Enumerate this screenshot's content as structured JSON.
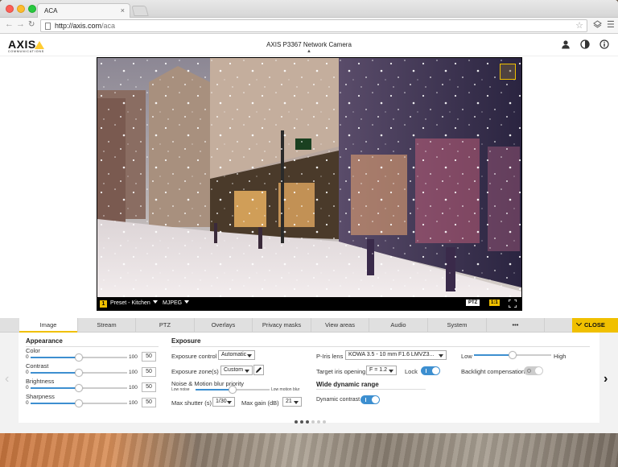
{
  "browser": {
    "tab_title": "ACA",
    "tab_close": "×",
    "url_host": "http://axis.com",
    "url_path": "/aca"
  },
  "header": {
    "logo_word": "AXIS",
    "logo_sub": "COMMUNICATIONS",
    "device_name": "AXIS P3367 Network Camera"
  },
  "video": {
    "preset_number": "1",
    "preset_label": "Preset - Kitchen",
    "codec": "MJPEG",
    "ptz_badge": "PTZ",
    "scale_badge": "1:1"
  },
  "tabs": [
    {
      "label": "Image"
    },
    {
      "label": "Stream"
    },
    {
      "label": "PTZ"
    },
    {
      "label": "Overlays"
    },
    {
      "label": "Privacy masks"
    },
    {
      "label": "View areas"
    },
    {
      "label": "Audio"
    },
    {
      "label": "System"
    },
    {
      "label": "•••"
    }
  ],
  "close_label": "CLOSE",
  "appearance": {
    "title": "Appearance",
    "sliders": [
      {
        "label": "Color",
        "min": "0",
        "max": "100",
        "value": "50",
        "level": 0.5
      },
      {
        "label": "Contrast",
        "min": "0",
        "max": "100",
        "value": "50",
        "level": 0.5
      },
      {
        "label": "Brightness",
        "min": "0",
        "max": "100",
        "value": "50",
        "level": 0.5
      },
      {
        "label": "Sharpness",
        "min": "0",
        "max": "100",
        "value": "50",
        "level": 0.5
      }
    ]
  },
  "exposure": {
    "title": "Exposure",
    "control_label": "Exposure control",
    "control_value": "Automatic",
    "zones_label": "Exposure zone(s)",
    "zones_value": "Custom",
    "priority_label": "Noise & Motion blur priority",
    "low_noise": "Low noise",
    "low_motion_blur": "Low motion blur",
    "priority_level": 0.5,
    "shutter_label": "Max shutter (s)",
    "shutter_value": "1/30",
    "gain_label": "Max gain (dB)",
    "gain_value": "21"
  },
  "iris": {
    "lens_label": "P-Iris lens",
    "lens_value": "KOWA 3.5 - 10 mm F1.6 LMVZ3...",
    "target_label": "Target iris opening",
    "target_value": "F = 1.2",
    "lock_label": "Lock",
    "lock_on": true
  },
  "wdr": {
    "title": "Wide dynamic range",
    "dynamic_contrast_label": "Dynamic contrast",
    "dynamic_contrast_on": true
  },
  "backlight": {
    "low_label": "Low",
    "high_label": "High",
    "level": 0.5,
    "compensation_label": "Backlight compensation",
    "compensation_on": false
  },
  "pagination": {
    "pages": 6,
    "current": 2
  }
}
